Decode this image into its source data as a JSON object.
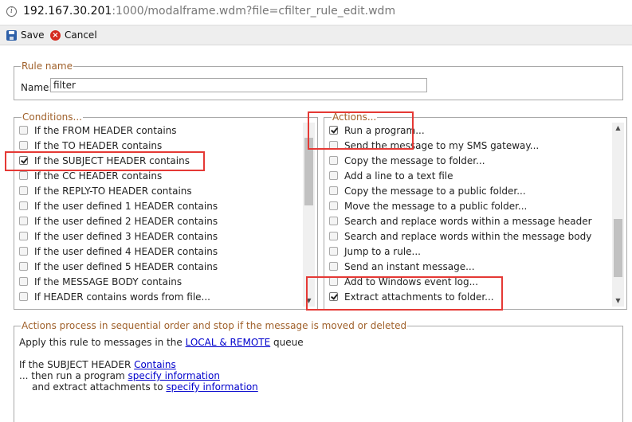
{
  "address_bar": {
    "host": "192.167.30.201",
    "rest": ":1000/modalframe.wdm?file=cfilter_rule_edit.wdm"
  },
  "toolbar": {
    "save_label": "Save",
    "cancel_label": "Cancel"
  },
  "rule_name": {
    "legend": "Rule name",
    "label": "Name:",
    "value": "filter"
  },
  "conditions": {
    "legend": "Conditions...",
    "items": [
      {
        "label": "If the FROM HEADER contains",
        "checked": false
      },
      {
        "label": "If the TO HEADER contains",
        "checked": false
      },
      {
        "label": "If the SUBJECT HEADER contains",
        "checked": true
      },
      {
        "label": "If the CC HEADER contains",
        "checked": false
      },
      {
        "label": "If the REPLY-TO HEADER contains",
        "checked": false
      },
      {
        "label": "If the user defined 1 HEADER contains",
        "checked": false
      },
      {
        "label": "If the user defined 2 HEADER contains",
        "checked": false
      },
      {
        "label": "If the user defined 3 HEADER contains",
        "checked": false
      },
      {
        "label": "If the user defined 4 HEADER contains",
        "checked": false
      },
      {
        "label": "If the user defined 5 HEADER contains",
        "checked": false
      },
      {
        "label": "If the MESSAGE BODY contains",
        "checked": false
      },
      {
        "label": "If HEADER contains words from file...",
        "checked": false
      }
    ]
  },
  "actions": {
    "legend": "Actions...",
    "items": [
      {
        "label": "Run a program...",
        "checked": true
      },
      {
        "label": "Send the message to my SMS gateway...",
        "checked": false
      },
      {
        "label": "Copy the message to folder...",
        "checked": false
      },
      {
        "label": "Add a line to a text file",
        "checked": false
      },
      {
        "label": "Copy the message to a public folder...",
        "checked": false
      },
      {
        "label": "Move the message to a public folder...",
        "checked": false
      },
      {
        "label": "Search and replace words within a message header",
        "checked": false
      },
      {
        "label": "Search and replace words within the message body",
        "checked": false
      },
      {
        "label": "Jump to a rule...",
        "checked": false
      },
      {
        "label": "Send an instant message...",
        "checked": false
      },
      {
        "label": "Add to Windows event log...",
        "checked": false
      },
      {
        "label": "Extract attachments to folder...",
        "checked": true
      }
    ]
  },
  "summary": {
    "legend": "Actions process in sequential order and stop if the message is moved or deleted",
    "apply_prefix": "Apply this rule to messages in the ",
    "apply_link": "LOCAL & REMOTE",
    "apply_suffix": " queue",
    "cond_prefix": "If the SUBJECT HEADER ",
    "cond_link": "Contains",
    "action1_prefix": "... then run a program ",
    "action1_link": "specify information",
    "action2_prefix": "and extract attachments to ",
    "action2_link": "specify information"
  },
  "colors": {
    "legend": "#a0612b",
    "link": "#0000cc",
    "highlight": "#e53935"
  }
}
